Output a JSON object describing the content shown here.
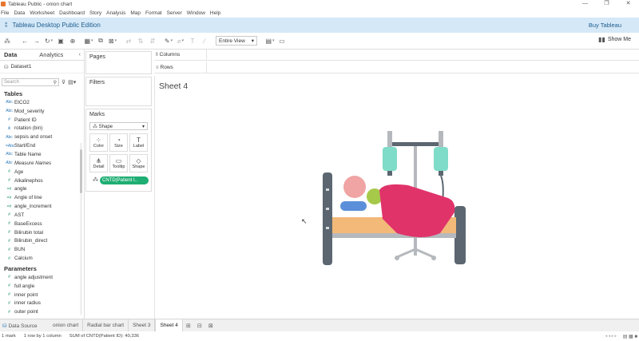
{
  "window": {
    "title": "Tableau Public - onion chart",
    "controls": [
      "—",
      "❐",
      "✕"
    ]
  },
  "menu": [
    "File",
    "Data",
    "Worksheet",
    "Dashboard",
    "Story",
    "Analysis",
    "Map",
    "Format",
    "Server",
    "Window",
    "Help"
  ],
  "banner": {
    "edition": "Tableau Desktop Public Edition",
    "buy": "Buy Tableau"
  },
  "toolbar": {
    "view": "Entire View",
    "show_me": "Show Me"
  },
  "data_pane": {
    "tab_data": "Data",
    "tab_analytics": "Analytics",
    "datasource": "Dataset1",
    "search_placeholder": "Search",
    "tables_title": "Tables",
    "fields": [
      {
        "label": "EtCO2",
        "type": "dim",
        "glyph": "Abc"
      },
      {
        "label": "Mod_severity",
        "type": "dim",
        "glyph": "Abc"
      },
      {
        "label": "Patient ID",
        "type": "dim",
        "glyph": "#"
      },
      {
        "label": "rotation (bin)",
        "type": "dim",
        "glyph": "ılı"
      },
      {
        "label": "sepsis and onset",
        "type": "dim",
        "glyph": "Abc"
      },
      {
        "label": "Start/End",
        "type": "dim",
        "glyph": "=Abc"
      },
      {
        "label": "Table Name",
        "type": "dim",
        "glyph": "Abc"
      },
      {
        "label": "Measure Names",
        "type": "dim",
        "glyph": "Abc",
        "italic": true
      },
      {
        "label": "Age",
        "type": "mea",
        "glyph": "#"
      },
      {
        "label": "Alkalinephos",
        "type": "mea",
        "glyph": "#"
      },
      {
        "label": "angle",
        "type": "mea",
        "glyph": "=#"
      },
      {
        "label": "Angle of line",
        "type": "mea",
        "glyph": "=#"
      },
      {
        "label": "angle_increment",
        "type": "mea",
        "glyph": "=#"
      },
      {
        "label": "AST",
        "type": "mea",
        "glyph": "#"
      },
      {
        "label": "BaseExcess",
        "type": "mea",
        "glyph": "#"
      },
      {
        "label": "Bilirubin total",
        "type": "mea",
        "glyph": "#"
      },
      {
        "label": "Bilirubin_direct",
        "type": "mea",
        "glyph": "#"
      },
      {
        "label": "BUN",
        "type": "mea",
        "glyph": "#"
      },
      {
        "label": "Calcium",
        "type": "mea",
        "glyph": "#"
      }
    ],
    "parameters_title": "Parameters",
    "parameters": [
      "angle adjustment",
      "full angle",
      "inner point",
      "inner radius",
      "outer point"
    ]
  },
  "shelves": {
    "pages": "Pages",
    "filters": "Filters",
    "marks": "Marks",
    "mark_type": "Shape",
    "buttons": [
      {
        "label": "Color",
        "icon": "color-icon",
        "glyph": "⁘"
      },
      {
        "label": "Size",
        "icon": "size-icon",
        "glyph": "◔"
      },
      {
        "label": "Label",
        "icon": "label-icon",
        "glyph": "T"
      },
      {
        "label": "Detail",
        "icon": "detail-icon",
        "glyph": "⋔"
      },
      {
        "label": "Tooltip",
        "icon": "tooltip-icon",
        "glyph": "▭"
      },
      {
        "label": "Shape",
        "icon": "shape-icon",
        "glyph": "◇"
      }
    ],
    "pill": "CNTD(Patient I..",
    "columns": "Columns",
    "rows": "Rows"
  },
  "sheet": {
    "title": "Sheet 4"
  },
  "tabs": {
    "datasource": "Data Source",
    "sheets": [
      "onion chart",
      "Radial bar chart",
      "Sheet 3",
      "Sheet 4"
    ],
    "active": "Sheet 4"
  },
  "status": {
    "mark": "1 mark",
    "dims": "1 row by 1 column",
    "sum": "SUM of CNTD(Patient ID): 40,336"
  },
  "colors": {
    "banner": "#d5e8f7",
    "pill": "#1fae73",
    "bed_frame": "#5b6670",
    "blanket": "#e0336a",
    "mattress": "#f2b979",
    "iv_bag": "#7fdcc8"
  }
}
